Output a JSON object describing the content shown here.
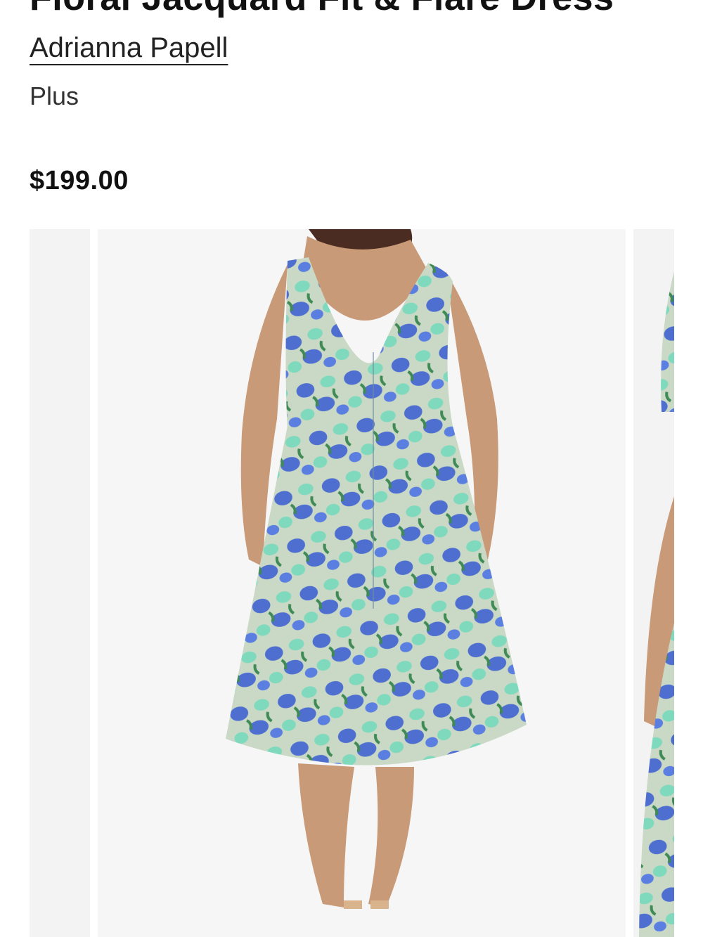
{
  "product": {
    "title": "Floral Jacquard Fit & Flare Dress",
    "brand": "Adrianna Papell",
    "size_type": "Plus",
    "price": "$199.00"
  },
  "gallery": {
    "main_image": "dress-back-view",
    "colors": {
      "background": "#f6f6f6",
      "skin": "#c99a78",
      "fabric_base": "#c9d9c6",
      "flower_blue": "#4e6fd0",
      "flower_mint": "#7fd9bd",
      "leaf_green": "#3f8a55"
    }
  }
}
